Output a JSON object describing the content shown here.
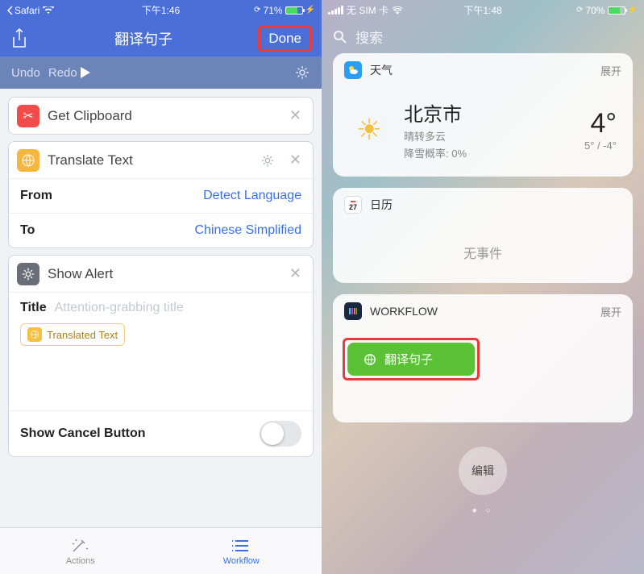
{
  "left": {
    "status": {
      "back": "Safari",
      "time": "下午1:46",
      "battery": "71%"
    },
    "nav": {
      "title": "翻译句子",
      "done": "Done"
    },
    "toolbar": {
      "undo": "Undo",
      "redo": "Redo"
    },
    "steps": {
      "clipboard": {
        "title": "Get Clipboard"
      },
      "translate": {
        "title": "Translate Text",
        "from_label": "From",
        "from_value": "Detect Language",
        "to_label": "To",
        "to_value": "Chinese Simplified"
      },
      "alert": {
        "title": "Show Alert",
        "title_label": "Title",
        "title_placeholder": "Attention-grabbing title",
        "token": "Translated Text",
        "cancel_label": "Show Cancel Button"
      }
    },
    "tabs": {
      "actions": "Actions",
      "workflow": "Workflow"
    }
  },
  "right": {
    "status": {
      "carrier": "无 SIM 卡",
      "time": "下午1:48",
      "battery": "70%"
    },
    "search_placeholder": "搜索",
    "weather": {
      "label": "天气",
      "expand": "展开",
      "city": "北京市",
      "cond": "晴转多云",
      "snow": "降雪概率: 0%",
      "temp": "4°",
      "range": "5° / -4°"
    },
    "calendar": {
      "label": "日历",
      "day": "27",
      "empty": "无事件"
    },
    "workflow": {
      "label": "WORKFLOW",
      "expand": "展开",
      "button": "翻译句子"
    },
    "edit": "编辑"
  }
}
